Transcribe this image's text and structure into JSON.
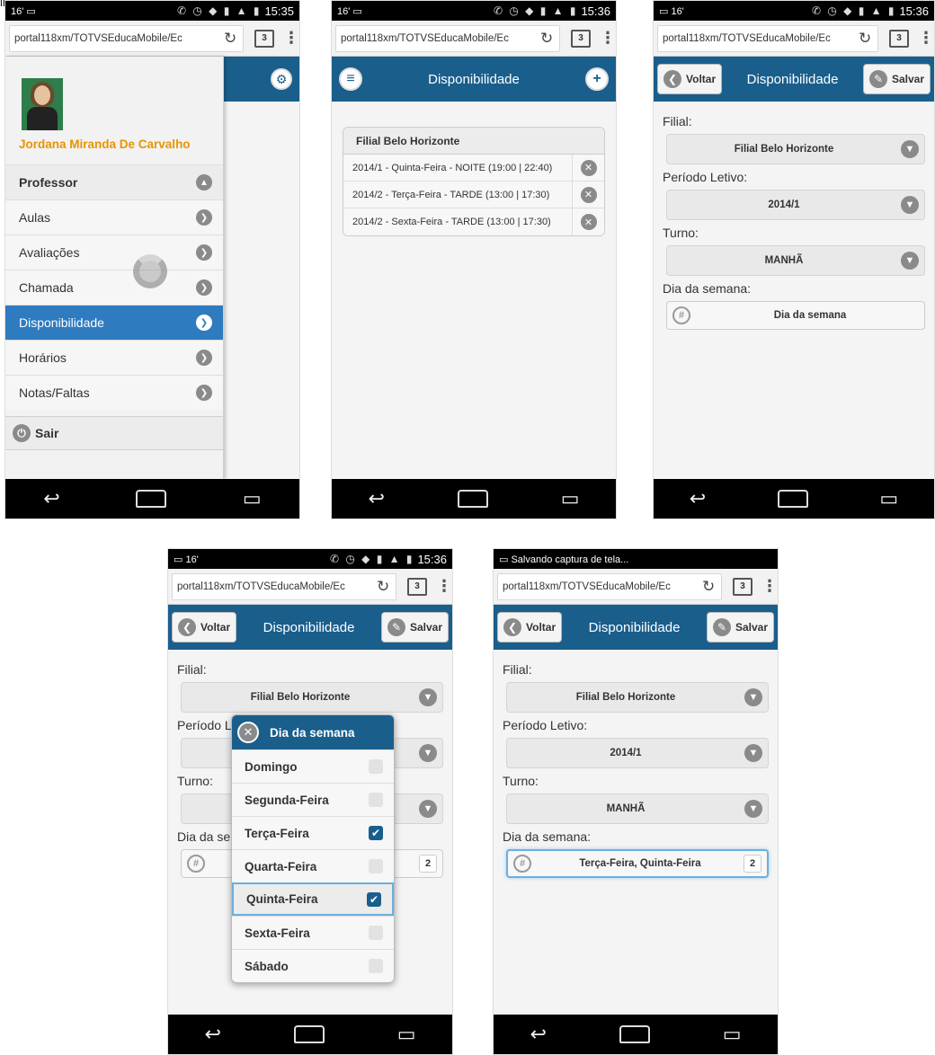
{
  "common": {
    "url": "portal118xm/TOTVSEducaMobile/Ec",
    "tabs_count": "3",
    "time_1": "15:35",
    "time_2": "15:36",
    "back_label": "Voltar",
    "save_label": "Salvar",
    "screen_title": "Disponibilidade"
  },
  "panel5": {
    "status_text": "Salvando captura de tela..."
  },
  "drawer": {
    "user_name": "Jordana Miranda De Carvalho",
    "items": [
      {
        "label": "Professor"
      },
      {
        "label": "Aulas"
      },
      {
        "label": "Avaliações"
      },
      {
        "label": "Chamada"
      },
      {
        "label": "Disponibilidade"
      },
      {
        "label": "Horários"
      },
      {
        "label": "Notas/Faltas"
      }
    ],
    "logout_label": "Sair"
  },
  "list": {
    "header": "Filial Belo Horizonte",
    "rows": [
      {
        "text": "2014/1 - Quinta-Feira - NOITE (19:00 | 22:40)"
      },
      {
        "text": "2014/2 - Terça-Feira - TARDE (13:00 | 17:30)"
      },
      {
        "text": "2014/2 - Sexta-Feira - TARDE (13:00 | 17:30)"
      }
    ]
  },
  "form": {
    "filial_label": "Filial:",
    "filial_value": "Filial Belo Horizonte",
    "periodo_label": "Período Letivo:",
    "periodo_value": "2014/1",
    "turno_label": "Turno:",
    "turno_value": "MANHÃ",
    "dia_label": "Dia da semana:",
    "dia_placeholder": "Dia da semana",
    "dia_value_selected": "Terça-Feira, Quinta-Feira",
    "dia_count": "2",
    "popup_dia_label_partial": "Dia da se",
    "popup_periodo_label_partial": "Período L",
    "popup_turno_label": "Turno:"
  },
  "popup": {
    "title": "Dia da semana",
    "options": [
      {
        "label": "Domingo",
        "checked": false
      },
      {
        "label": "Segunda-Feira",
        "checked": false
      },
      {
        "label": "Terça-Feira",
        "checked": true
      },
      {
        "label": "Quarta-Feira",
        "checked": false
      },
      {
        "label": "Quinta-Feira",
        "checked": true
      },
      {
        "label": "Sexta-Feira",
        "checked": false
      },
      {
        "label": "Sábado",
        "checked": false
      }
    ]
  },
  "icons": {
    "reload": "reload-icon",
    "tabs": "tabs-icon",
    "overflow": "overflow-menu-icon",
    "chevron": "chevron-down-icon",
    "arrow": "arrow-right-icon",
    "delete": "delete-icon",
    "calendar": "globe-grid-icon",
    "checkbox": "checkbox-icon"
  },
  "colors": {
    "header": "#1a5e8c",
    "selected": "#2f7bbf",
    "accent_name": "#e89400"
  }
}
